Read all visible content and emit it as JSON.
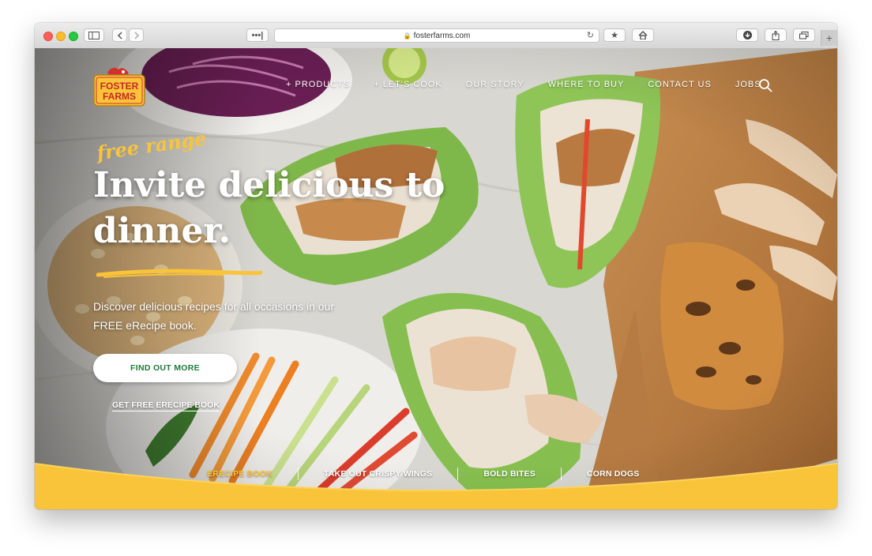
{
  "browser": {
    "url": "fosterfarms.com",
    "buttons": {
      "sidebar": "sidebar-icon",
      "back": "chevron-left-icon",
      "forward": "chevron-right-icon",
      "reader": "•••|",
      "bookmark": "star-icon",
      "home": "home-icon",
      "download": "download-icon",
      "share": "share-icon",
      "tabs": "tabs-icon",
      "new_tab": "+"
    }
  },
  "site": {
    "logo_line1": "FOSTER",
    "logo_line2": "FARMS",
    "nav": [
      "+ PRODUCTS",
      "+ LET'S COOK",
      "OUR STORY",
      "WHERE TO BUY",
      "CONTACT US",
      "JOBS"
    ],
    "search_icon": "search-icon"
  },
  "hero": {
    "script_tag": "free range",
    "headline": "Invite delicious to dinner.",
    "subtext": "Discover delicious recipes for all occasions in our FREE eRecipe book.",
    "cta_button": "FIND OUT MORE",
    "cta_link": "GET FREE ERECIPE BOOK"
  },
  "quick_links": [
    "ERECIPE BOOK",
    "TAKE OUT CRISPY WINGS",
    "BOLD BITES",
    "CORN DOGS"
  ],
  "colors": {
    "brand_yellow": "#f9c43a",
    "cta_green": "#1f7a3a",
    "logo_red": "#d32f2f"
  }
}
